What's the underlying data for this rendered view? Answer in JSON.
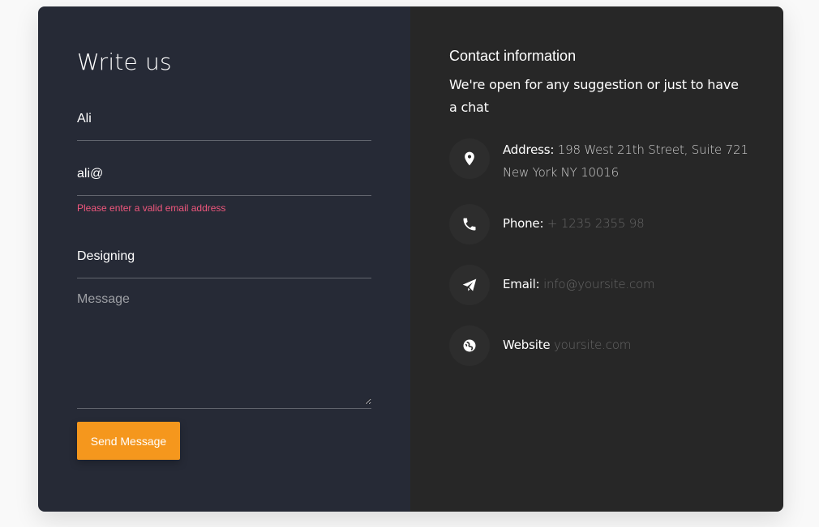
{
  "form": {
    "title": "Write us",
    "name_value": "Ali",
    "email_value": "ali@",
    "email_error": "Please enter a valid email address",
    "subject_value": "Designing",
    "message_placeholder": "Message",
    "send_label": "Send Message"
  },
  "contact": {
    "title": "Contact information",
    "description": "We're open for any suggestion or just to have a chat",
    "items": [
      {
        "icon": "map-marker-icon",
        "label": "Address:",
        "value": "198 West 21th Street, Suite 721 New York NY 10016"
      },
      {
        "icon": "phone-icon",
        "label": "Phone:",
        "value": "+ 1235 2355 98"
      },
      {
        "icon": "paper-plane-icon",
        "label": "Email:",
        "value": "info@yoursite.com"
      },
      {
        "icon": "globe-icon",
        "label": "Website",
        "value": "yoursite.com"
      }
    ]
  },
  "colors": {
    "form_bg": "#262a36",
    "info_bg": "#272727",
    "accent": "#f5971d",
    "error": "#f0577d"
  }
}
